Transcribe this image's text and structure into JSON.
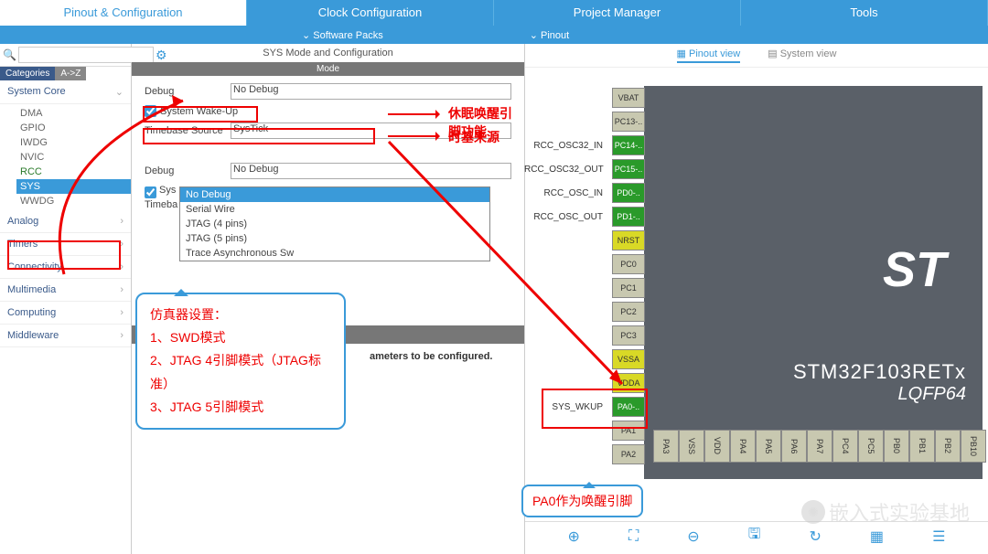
{
  "tabs": [
    "Pinout & Configuration",
    "Clock Configuration",
    "Project Manager",
    "Tools"
  ],
  "subbar": {
    "a": "Software Packs",
    "b": "Pinout"
  },
  "left": {
    "search_placeholder": "",
    "cat": "Categories",
    "az": "A->Z",
    "groups": {
      "system_core": "System Core",
      "analog": "Analog",
      "timers": "Timers",
      "connectivity": "Connectivity",
      "multimedia": "Multimedia",
      "computing": "Computing",
      "middleware": "Middleware"
    },
    "items": [
      "DMA",
      "GPIO",
      "IWDG",
      "NVIC",
      "RCC",
      "SYS",
      "WWDG"
    ]
  },
  "center": {
    "title": "SYS Mode and Configuration",
    "modebar": "Mode",
    "debug_label": "Debug",
    "debug_val": "No Debug",
    "wake_label": "System Wake-Up",
    "timebase_label": "Timebase Source",
    "timebase_val": "SysTick",
    "debug2_label": "Debug",
    "debug2_val": "No Debug",
    "sys_label": "Sys",
    "time_label": "Timeba",
    "dropdown": [
      "No Debug",
      "Serial Wire",
      "JTAG (4 pins)",
      "JTAG (5 pins)",
      "Trace Asynchronous Sw"
    ],
    "paramtxt": "ameters to be configured.",
    "anno_wake": "休眠唤醒引脚功能",
    "anno_time": "时基来源",
    "callout_title": "仿真器设置：",
    "callout_1": "1、SWD模式",
    "callout_2": "2、JTAG 4引脚模式（JTAG标准）",
    "callout_3": "3、JTAG 5引脚模式"
  },
  "right": {
    "pinout_view": "Pinout view",
    "system_view": "System view",
    "chip_name": "STM32F103RETx",
    "chip_pkg": "LQFP64",
    "st": "ST",
    "pins_left": [
      {
        "lbl": "VBAT",
        "sig": "",
        "cls": ""
      },
      {
        "lbl": "PC13-..",
        "sig": "",
        "cls": ""
      },
      {
        "lbl": "PC14-..",
        "sig": "RCC_OSC32_IN",
        "cls": "green"
      },
      {
        "lbl": "PC15-..",
        "sig": "RCC_OSC32_OUT",
        "cls": "green"
      },
      {
        "lbl": "PD0-..",
        "sig": "RCC_OSC_IN",
        "cls": "green"
      },
      {
        "lbl": "PD1-..",
        "sig": "RCC_OSC_OUT",
        "cls": "green"
      },
      {
        "lbl": "NRST",
        "sig": "",
        "cls": "yellow"
      },
      {
        "lbl": "PC0",
        "sig": "",
        "cls": ""
      },
      {
        "lbl": "PC1",
        "sig": "",
        "cls": ""
      },
      {
        "lbl": "PC2",
        "sig": "",
        "cls": ""
      },
      {
        "lbl": "PC3",
        "sig": "",
        "cls": ""
      },
      {
        "lbl": "VSSA",
        "sig": "",
        "cls": "yellow"
      },
      {
        "lbl": "VDDA",
        "sig": "",
        "cls": "yellow"
      },
      {
        "lbl": "PA0-..",
        "sig": "SYS_WKUP",
        "cls": "green"
      },
      {
        "lbl": "PA1",
        "sig": "",
        "cls": ""
      },
      {
        "lbl": "PA2",
        "sig": "",
        "cls": ""
      }
    ],
    "pins_bot": [
      "PA3",
      "VSS",
      "VDD",
      "PA4",
      "PA5",
      "PA6",
      "PA7",
      "PC4",
      "PC5",
      "PB0",
      "PB1",
      "PB2",
      "PB10"
    ],
    "callout2": "PA0作为唤醒引脚"
  },
  "watermark": "嵌入式实验基地"
}
